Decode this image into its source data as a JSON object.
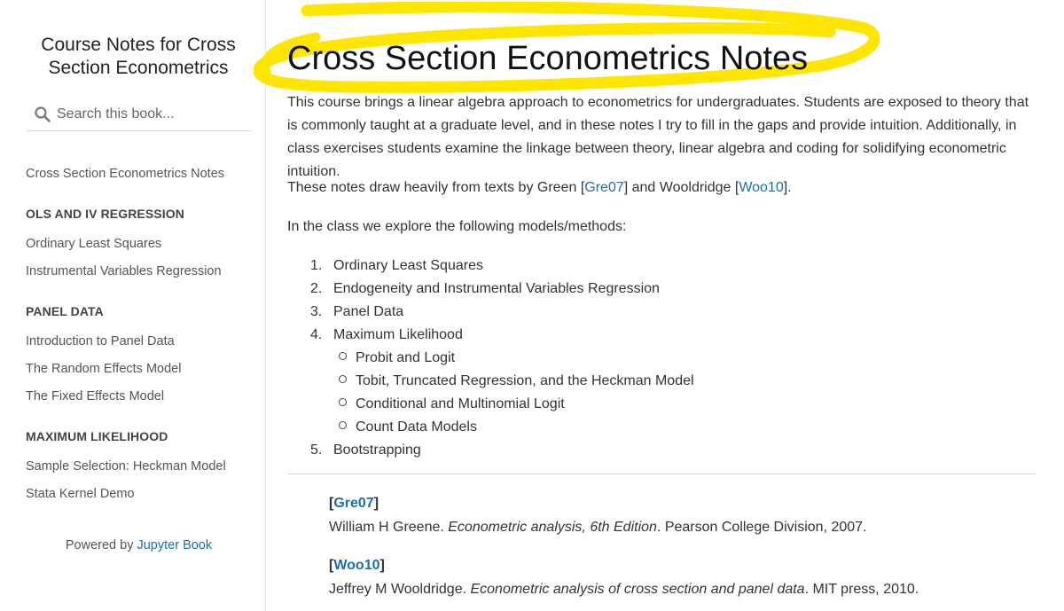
{
  "sidebar": {
    "book_title": "Course Notes for Cross Section Econometrics",
    "search_placeholder": "Search this book...",
    "nav": {
      "home": "Cross Section Econometrics Notes",
      "sections": [
        {
          "caption": "OLS AND IV REGRESSION",
          "items": [
            "Ordinary Least Squares",
            "Instrumental Variables Regression"
          ]
        },
        {
          "caption": "PANEL DATA",
          "items": [
            "Introduction to Panel Data",
            "The Random Effects Model",
            "The Fixed Effects Model"
          ]
        },
        {
          "caption": "MAXIMUM LIKELIHOOD",
          "items": [
            "Sample Selection: Heckman Model",
            "Stata Kernel Demo"
          ]
        }
      ]
    },
    "powered_by_prefix": "Powered by ",
    "powered_by_link": "Jupyter Book"
  },
  "main": {
    "title": "Cross Section Econometrics Notes",
    "intro": "This course brings a linear algebra approach to econometrics for undergraduates. Students are exposed to theory that is commonly taught at a graduate level, and in these notes I try to fill in the gaps and provide intuition. Additionally, in class exercises students examine the linkage between theory, linear algebra and coding for solidifying econometric intuition.",
    "draw": {
      "prefix": "These notes draw heavily from texts by Green ",
      "ref1": "Gre07",
      "middle": " and Wooldridge ",
      "ref2": "Woo10",
      "suffix": "."
    },
    "models_intro": "In the class we explore the following models/methods:",
    "models": [
      {
        "num": "1.",
        "label": "Ordinary Least Squares"
      },
      {
        "num": "2.",
        "label": "Endogeneity and Instrumental Variables Regression"
      },
      {
        "num": "3.",
        "label": "Panel Data"
      },
      {
        "num": "4.",
        "label": "Maximum Likelihood",
        "sub": [
          "Probit and Logit",
          "Tobit, Truncated Regression, and the Heckman Model",
          "Conditional and Multinomial Logit",
          "Count Data Models"
        ]
      },
      {
        "num": "5.",
        "label": "Bootstrapping"
      }
    ],
    "references": [
      {
        "key": "Gre07",
        "author": "William H Greene. ",
        "title": "Econometric analysis, 6th Edition",
        "rest": ". Pearson College Division, 2007."
      },
      {
        "key": "Woo10",
        "author": "Jeffrey M Wooldridge. ",
        "title": "Econometric analysis of cross section and panel data",
        "rest": ". MIT press, 2010."
      }
    ]
  },
  "colors": {
    "link": "#1a6fa8",
    "highlight": "#ffe600"
  }
}
